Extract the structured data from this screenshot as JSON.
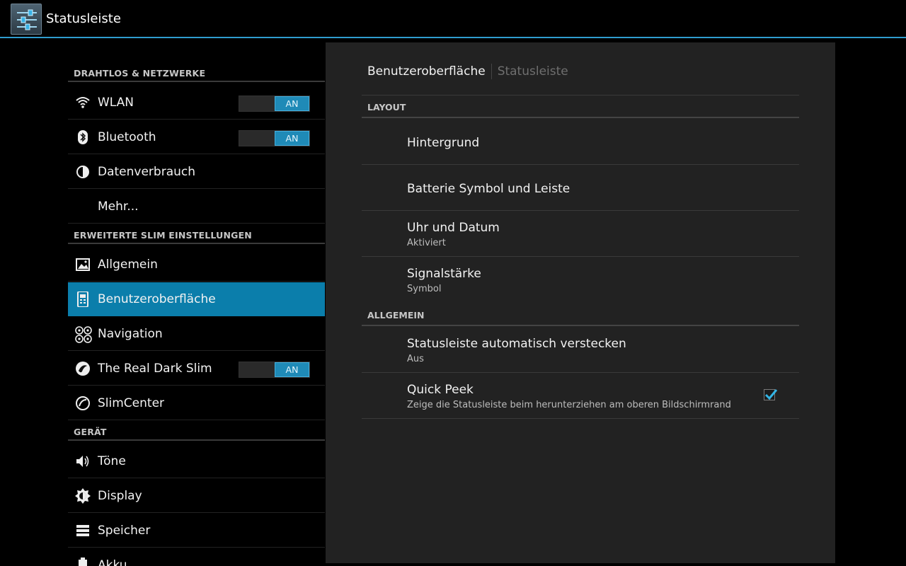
{
  "actionbar": {
    "title": "Statusleiste",
    "icon": "settings-sliders-icon"
  },
  "colors": {
    "accent": "#2f9ccf",
    "selected": "#0b7eab",
    "switch_on": "#1f8ab7"
  },
  "sidebar": {
    "categories": [
      "DRAHTLOS & NETZWERKE",
      "ERWEITERTE SLIM EINSTELLUNGEN",
      "GERÄT"
    ],
    "items": [
      {
        "label": "WLAN",
        "icon": "wifi-icon",
        "switch": "AN"
      },
      {
        "label": "Bluetooth",
        "icon": "bluetooth-icon",
        "switch": "AN"
      },
      {
        "label": "Datenverbrauch",
        "icon": "data-usage-icon"
      },
      {
        "label": "Mehr...",
        "icon": ""
      },
      {
        "label": "Allgemein",
        "icon": "image-icon"
      },
      {
        "label": "Benutzeroberfläche",
        "icon": "phone-ui-icon",
        "selected": true
      },
      {
        "label": "Navigation",
        "icon": "navigation-icon"
      },
      {
        "label": "The Real Dark Slim",
        "icon": "slim-logo-icon",
        "switch": "AN"
      },
      {
        "label": "SlimCenter",
        "icon": "slimcenter-icon"
      },
      {
        "label": "Töne",
        "icon": "speaker-icon"
      },
      {
        "label": "Display",
        "icon": "brightness-icon"
      },
      {
        "label": "Speicher",
        "icon": "storage-icon"
      },
      {
        "label": "Akku",
        "icon": "battery-icon"
      }
    ]
  },
  "main": {
    "breadcrumb": [
      "Benutzeroberfläche",
      "Statusleiste"
    ],
    "categories": [
      "LAYOUT",
      "ALLGEMEIN"
    ],
    "prefs": [
      {
        "title": "Hintergrund",
        "summary": ""
      },
      {
        "title": "Batterie Symbol und Leiste",
        "summary": ""
      },
      {
        "title": "Uhr und Datum",
        "summary": "Aktiviert"
      },
      {
        "title": "Signalstärke",
        "summary": "Symbol"
      },
      {
        "title": "Statusleiste automatisch verstecken",
        "summary": "Aus"
      },
      {
        "title": "Quick Peek",
        "summary": "Zeige die Statusleiste beim herunterziehen am oberen Bildschirmrand",
        "checked": true
      }
    ]
  }
}
